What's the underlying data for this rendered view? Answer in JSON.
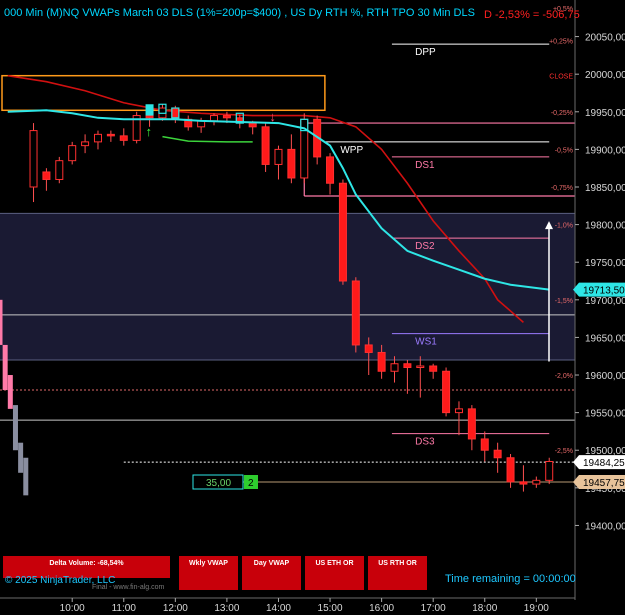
{
  "header": {
    "title": "000 Min (M)NQ VWAPs March 03 DLS (1%=200p=$400) , US Dy RTH %, RTH TPO 30 Min DLS",
    "pnl": "D -2,53% = -506,75"
  },
  "buttons": {
    "delta_volume": "Delta Volume: -68,54%",
    "wkly_vwap": "Wkly VWAP",
    "day_vwap": "Day VWAP",
    "us_eth_or": "US ETH OR",
    "us_rth_or": "US RTH OR"
  },
  "footer": {
    "copyright": "© 2025 NinjaTrader, LLC",
    "url": "Final - www.fin-alg.com",
    "time_remaining": "Time remaining = 00:00:00"
  },
  "colors": {
    "background": "#000000",
    "up_candle": "#ff2020",
    "vwap_cyan": "#2ee6e6",
    "wkly_vwap_red": "#d01010",
    "pink_level": "#ff7aa8",
    "value_area": "#1a1a33",
    "accent_text": "#00d7ff"
  },
  "chart_data": {
    "type": "candlestick",
    "instrument": "(M)NQ",
    "x_ticks": [
      "10:00",
      "11:00",
      "12:00",
      "13:00",
      "14:00",
      "15:00",
      "16:00",
      "17:00",
      "18:00",
      "19:00"
    ],
    "y_ticks": [
      "20050,00",
      "20000,00",
      "19950,00",
      "19900,00",
      "19850,00",
      "19800,00",
      "19750,00",
      "19700,00",
      "19650,00",
      "19600,00",
      "19550,00",
      "19500,00",
      "19450,00",
      "19400,00"
    ],
    "y_tick_values": [
      20050,
      20000,
      19950,
      19900,
      19850,
      19800,
      19750,
      19700,
      19650,
      19600,
      19550,
      19500,
      19450,
      19400
    ],
    "ylim": [
      19370,
      20088
    ],
    "percent_ticks": [
      {
        "label": "+0,5%",
        "value": 20088
      },
      {
        "label": "+0,25%",
        "value": 20045
      },
      {
        "label": "CLOSE",
        "value": 19998
      },
      {
        "label": "-0,25%",
        "value": 19950
      },
      {
        "label": "-0,5%",
        "value": 19900
      },
      {
        "label": "-0,75%",
        "value": 19850
      },
      {
        "label": "-1,0%",
        "value": 19800
      },
      {
        "label": "-1,5%",
        "value": 19700
      },
      {
        "label": "-2,0%",
        "value": 19600
      },
      {
        "label": "-2,5%",
        "value": 19500
      }
    ],
    "price_badges": [
      {
        "label": "19713,50",
        "value": 19713.5,
        "color": "#2ee6e6"
      },
      {
        "label": "19484,25",
        "value": 19484.25,
        "color": "#ffffff"
      },
      {
        "label": "19457,75",
        "value": 19457.75,
        "color": "#e8c39a"
      }
    ],
    "levels": [
      {
        "label": "DPP",
        "value": 20040,
        "color": "#ffffff"
      },
      {
        "label": "WPP",
        "value": 19910,
        "color": "#ffffff"
      },
      {
        "label": "DS1",
        "value": 19890,
        "color": "#ff7aa8"
      },
      {
        "label": "DS2",
        "value": 19782,
        "color": "#ff7aa8"
      },
      {
        "label": "WS1",
        "value": 19655,
        "color": "#9b7bff"
      },
      {
        "label": "DS3",
        "value": 19522,
        "color": "#ff7aa8"
      }
    ],
    "ib_count": "35,00",
    "ib_flag": "2",
    "candles": [
      {
        "t": 9.25,
        "o": 19850,
        "h": 19935,
        "l": 19830,
        "c": 19925
      },
      {
        "t": 9.5,
        "o": 19870,
        "h": 19875,
        "l": 19845,
        "c": 19860
      },
      {
        "t": 9.75,
        "o": 19860,
        "h": 19890,
        "l": 19855,
        "c": 19885
      },
      {
        "t": 10.0,
        "o": 19885,
        "h": 19910,
        "l": 19880,
        "c": 19905
      },
      {
        "t": 10.25,
        "o": 19905,
        "h": 19920,
        "l": 19895,
        "c": 19910
      },
      {
        "t": 10.5,
        "o": 19910,
        "h": 19925,
        "l": 19900,
        "c": 19920
      },
      {
        "t": 10.75,
        "o": 19920,
        "h": 19925,
        "l": 19910,
        "c": 19918
      },
      {
        "t": 11.0,
        "o": 19918,
        "h": 19928,
        "l": 19905,
        "c": 19912
      },
      {
        "t": 11.25,
        "o": 19912,
        "h": 19950,
        "l": 19908,
        "c": 19945
      },
      {
        "t": 11.5,
        "o": 19945,
        "h": 19955,
        "l": 19930,
        "c": 19942
      },
      {
        "t": 11.75,
        "o": 19942,
        "h": 19960,
        "l": 19938,
        "c": 19955
      },
      {
        "t": 12.0,
        "o": 19955,
        "h": 19958,
        "l": 19935,
        "c": 19940
      },
      {
        "t": 12.25,
        "o": 19940,
        "h": 19945,
        "l": 19925,
        "c": 19930
      },
      {
        "t": 12.5,
        "o": 19930,
        "h": 19942,
        "l": 19922,
        "c": 19938
      },
      {
        "t": 12.75,
        "o": 19938,
        "h": 19948,
        "l": 19932,
        "c": 19945
      },
      {
        "t": 13.0,
        "o": 19945,
        "h": 19950,
        "l": 19935,
        "c": 19942
      },
      {
        "t": 13.25,
        "o": 19942,
        "h": 19946,
        "l": 19928,
        "c": 19935
      },
      {
        "t": 13.5,
        "o": 19935,
        "h": 19938,
        "l": 19920,
        "c": 19930
      },
      {
        "t": 13.75,
        "o": 19930,
        "h": 19935,
        "l": 19870,
        "c": 19880
      },
      {
        "t": 14.0,
        "o": 19880,
        "h": 19905,
        "l": 19860,
        "c": 19900
      },
      {
        "t": 14.25,
        "o": 19900,
        "h": 19920,
        "l": 19855,
        "c": 19862
      },
      {
        "t": 14.5,
        "o": 19862,
        "h": 19948,
        "l": 19855,
        "c": 19940
      },
      {
        "t": 14.75,
        "o": 19940,
        "h": 19945,
        "l": 19880,
        "c": 19890
      },
      {
        "t": 15.0,
        "o": 19890,
        "h": 19895,
        "l": 19840,
        "c": 19855
      },
      {
        "t": 15.25,
        "o": 19855,
        "h": 19860,
        "l": 19720,
        "c": 19725
      },
      {
        "t": 15.5,
        "o": 19725,
        "h": 19730,
        "l": 19630,
        "c": 19640
      },
      {
        "t": 15.75,
        "o": 19640,
        "h": 19650,
        "l": 19600,
        "c": 19630
      },
      {
        "t": 16.0,
        "o": 19630,
        "h": 19640,
        "l": 19595,
        "c": 19605
      },
      {
        "t": 16.25,
        "o": 19605,
        "h": 19625,
        "l": 19590,
        "c": 19615
      },
      {
        "t": 16.5,
        "o": 19615,
        "h": 19620,
        "l": 19575,
        "c": 19610
      },
      {
        "t": 16.75,
        "o": 19610,
        "h": 19625,
        "l": 19570,
        "c": 19612
      },
      {
        "t": 17.0,
        "o": 19612,
        "h": 19615,
        "l": 19595,
        "c": 19605
      },
      {
        "t": 17.25,
        "o": 19605,
        "h": 19610,
        "l": 19545,
        "c": 19550
      },
      {
        "t": 17.5,
        "o": 19550,
        "h": 19565,
        "l": 19520,
        "c": 19555
      },
      {
        "t": 17.75,
        "o": 19555,
        "h": 19560,
        "l": 19500,
        "c": 19515
      },
      {
        "t": 18.0,
        "o": 19515,
        "h": 19525,
        "l": 19485,
        "c": 19500
      },
      {
        "t": 18.25,
        "o": 19500,
        "h": 19510,
        "l": 19470,
        "c": 19490
      },
      {
        "t": 18.5,
        "o": 19490,
        "h": 19495,
        "l": 19450,
        "c": 19458
      },
      {
        "t": 18.75,
        "o": 19458,
        "h": 19480,
        "l": 19445,
        "c": 19455
      },
      {
        "t": 19.0,
        "o": 19455,
        "h": 19465,
        "l": 19450,
        "c": 19460
      },
      {
        "t": 19.25,
        "o": 19460,
        "h": 19490,
        "l": 19455,
        "c": 19485
      }
    ],
    "vwap_line": [
      [
        8.75,
        19950
      ],
      [
        9.5,
        19952
      ],
      [
        10.0,
        19948
      ],
      [
        10.5,
        19942
      ],
      [
        11.0,
        19940
      ],
      [
        11.5,
        19940
      ],
      [
        12.0,
        19940
      ],
      [
        12.5,
        19938
      ],
      [
        13.0,
        19937
      ],
      [
        13.5,
        19936
      ],
      [
        14.0,
        19935
      ],
      [
        14.5,
        19928
      ],
      [
        15.0,
        19905
      ],
      [
        15.25,
        19875
      ],
      [
        15.5,
        19840
      ],
      [
        16.0,
        19795
      ],
      [
        16.5,
        19765
      ],
      [
        17.0,
        19752
      ],
      [
        17.5,
        19740
      ],
      [
        18.0,
        19728
      ],
      [
        18.5,
        19720
      ],
      [
        19.25,
        19713.5
      ]
    ],
    "wkly_vwap_line": [
      [
        8.75,
        19998
      ],
      [
        9.5,
        19990
      ],
      [
        10.25,
        19978
      ],
      [
        11.0,
        19962
      ],
      [
        11.75,
        19952
      ],
      [
        12.5,
        19948
      ],
      [
        13.5,
        19945
      ],
      [
        14.5,
        19945
      ],
      [
        15.0,
        19942
      ],
      [
        15.5,
        19930
      ],
      [
        16.0,
        19900
      ],
      [
        16.5,
        19855
      ],
      [
        17.0,
        19805
      ],
      [
        17.5,
        19765
      ],
      [
        18.0,
        19728
      ],
      [
        18.25,
        19700
      ],
      [
        18.75,
        19670
      ]
    ],
    "green_line": [
      [
        11.75,
        19917
      ],
      [
        12.25,
        19911
      ],
      [
        13.0,
        19910
      ],
      [
        13.5,
        19910
      ]
    ],
    "profile_bars": [
      {
        "t": 8.55,
        "v": 19860,
        "w": 19955,
        "color": "#8fb8d8"
      },
      {
        "t": 8.6,
        "v": 19640,
        "w": 19700,
        "color": "#ff7aa8"
      },
      {
        "t": 8.7,
        "v": 19580,
        "w": 19640,
        "color": "#ff7aa8"
      },
      {
        "t": 8.8,
        "v": 19555,
        "w": 19600,
        "color": "#ff7aa8"
      },
      {
        "t": 8.9,
        "v": 19500,
        "w": 19560,
        "color": "#8a8ea0"
      },
      {
        "t": 9.0,
        "v": 19470,
        "w": 19510,
        "color": "#8a8ea0"
      },
      {
        "t": 9.1,
        "v": 19440,
        "w": 19490,
        "color": "#8a8ea0"
      }
    ]
  }
}
